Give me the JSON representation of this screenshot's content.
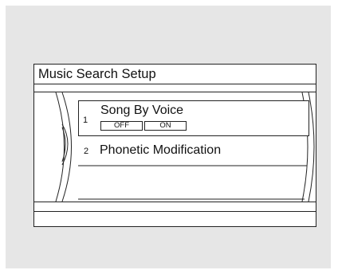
{
  "screen": {
    "title": "Music Search Setup",
    "items": [
      {
        "number": "1",
        "label": "Song By Voice",
        "options": [
          "OFF",
          "ON"
        ]
      },
      {
        "number": "2",
        "label": "Phonetic Modification"
      }
    ]
  }
}
